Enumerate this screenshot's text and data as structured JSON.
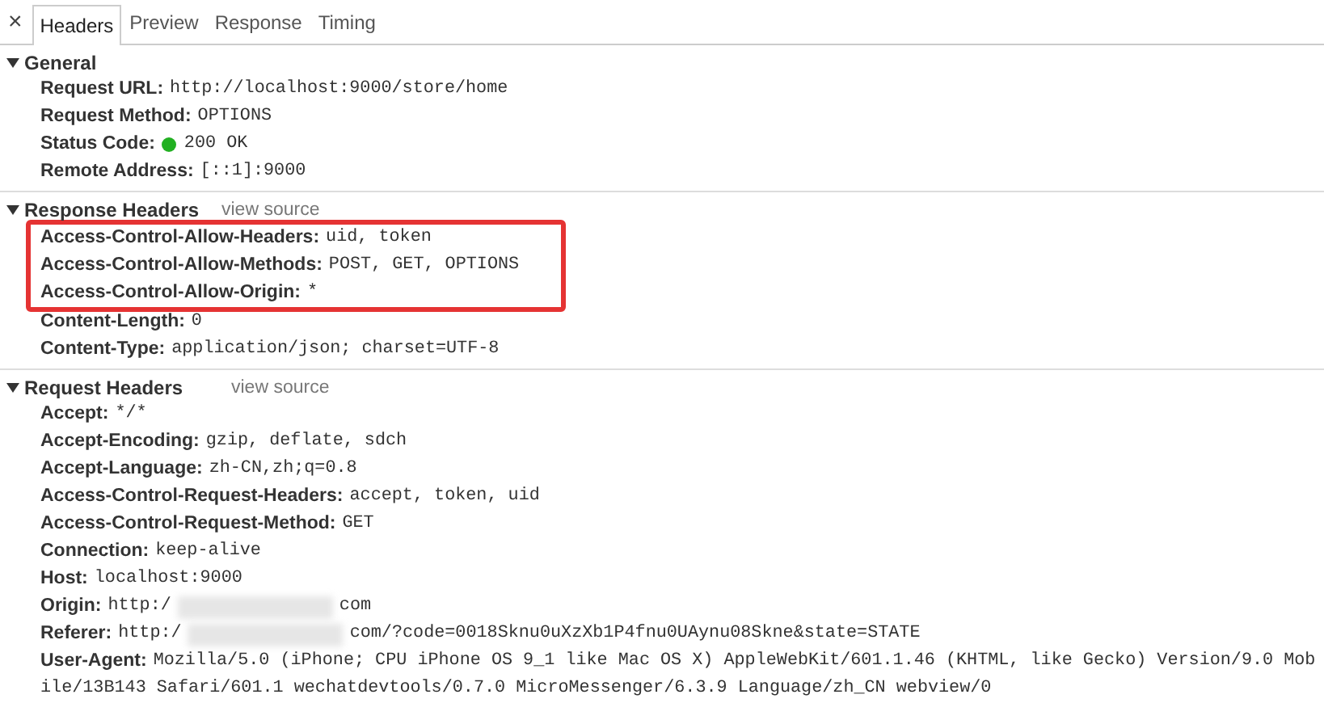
{
  "close_button": {
    "label": "×"
  },
  "tabs": [
    {
      "label": "Headers",
      "selected": true
    },
    {
      "label": "Preview",
      "selected": false
    },
    {
      "label": "Response",
      "selected": false
    },
    {
      "label": "Timing",
      "selected": false
    }
  ],
  "sections": [
    {
      "title": "General",
      "expanded": true,
      "rows": [
        {
          "kind": "plain",
          "name": "Request URL:",
          "value": "http://localhost:9000/store/home",
          "highlighted": false
        },
        {
          "kind": "plain",
          "name": "Request Method:",
          "value": "OPTIONS",
          "highlighted": false
        },
        {
          "kind": "status",
          "name": "Status Code:",
          "value": "200 OK",
          "highlighted": false
        },
        {
          "kind": "plain",
          "name": "Remote Address:",
          "value": "[::1]:9000",
          "highlighted": false
        }
      ]
    },
    {
      "title": "Response Headers",
      "expanded": true,
      "link": "view source",
      "rows": [
        {
          "kind": "plain",
          "name": "Access-Control-Allow-Headers:",
          "value": "uid, token",
          "highlighted": true
        },
        {
          "kind": "plain",
          "name": "Access-Control-Allow-Methods:",
          "value": "POST, GET, OPTIONS",
          "highlighted": true
        },
        {
          "kind": "plain",
          "name": "Access-Control-Allow-Origin:",
          "value": "*",
          "highlighted": true
        },
        {
          "kind": "plain",
          "name": "Content-Length:",
          "value": "0",
          "highlighted": false
        },
        {
          "kind": "plain",
          "name": "Content-Type:",
          "value": "application/json; charset=UTF-8",
          "highlighted": false
        }
      ]
    },
    {
      "title": "Request Headers",
      "expanded": true,
      "link": "view source",
      "rows": [
        {
          "kind": "plain",
          "name": "Accept:",
          "value": "*/*",
          "highlighted": false
        },
        {
          "kind": "plain",
          "name": "Accept-Encoding:",
          "value": "gzip, deflate, sdch",
          "highlighted": false
        },
        {
          "kind": "plain",
          "name": "Accept-Language:",
          "value": "zh-CN,zh;q=0.8",
          "highlighted": false
        },
        {
          "kind": "plain",
          "name": "Access-Control-Request-Headers:",
          "value": "accept, token, uid",
          "highlighted": false
        },
        {
          "kind": "plain",
          "name": "Access-Control-Request-Method:",
          "value": "GET",
          "highlighted": false
        },
        {
          "kind": "plain",
          "name": "Connection:",
          "value": "keep-alive",
          "highlighted": false
        },
        {
          "kind": "plain",
          "name": "Host:",
          "value": "localhost:9000",
          "highlighted": false
        },
        {
          "kind": "redacted",
          "name": "Origin:",
          "value": "http:/",
          "value_end": "com",
          "highlighted": false
        },
        {
          "kind": "redacted",
          "name": "Referer:",
          "value": "http:/",
          "value_end": "com/?code=0018Sknu0uXzXb1P4fnu0UAynu08Skne&state=STATE",
          "highlighted": false
        },
        {
          "kind": "wrapped",
          "name": "User-Agent:",
          "value": "Mozilla/5.0 (iPhone; CPU iPhone OS 9_1 like Mac OS X) AppleWebKit/601.1.46 (KHTML, like Gecko) Version/9.0 Mobile/13B143 Safari/601.1 wechatdevtools/0.7.0 MicroMessenger/6.3.9 Language/zh_CN webview/0",
          "highlighted": false
        }
      ]
    }
  ]
}
